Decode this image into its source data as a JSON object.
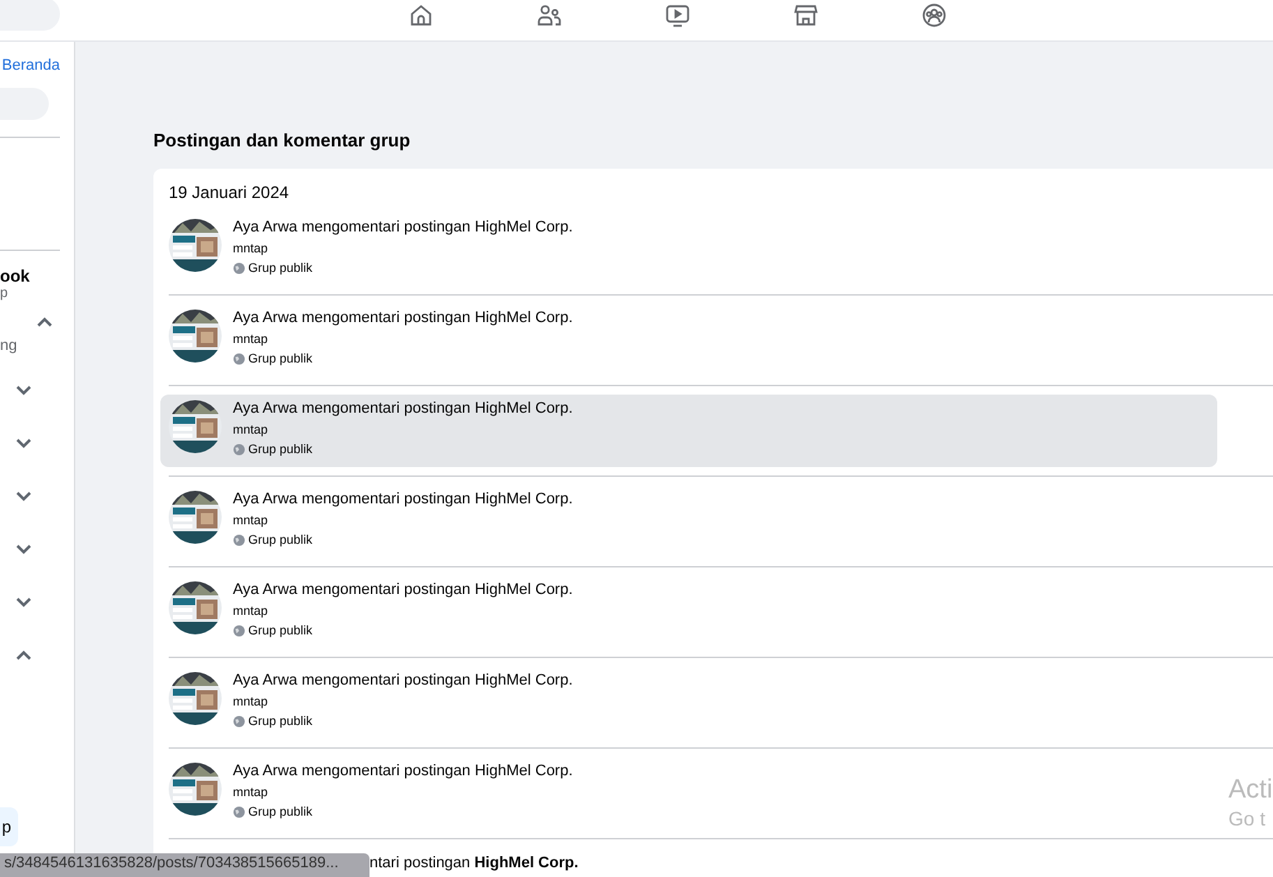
{
  "top_nav": {
    "tabs": [
      {
        "selected": false
      },
      {
        "selected": false
      },
      {
        "selected": false
      },
      {
        "selected": false
      },
      {
        "selected": false
      }
    ]
  },
  "sidebar": {
    "link": "Beranda",
    "heading": "ook",
    "subheading": "p",
    "sections": [
      {
        "label": "ng",
        "expanded": true
      },
      {
        "expanded": false
      },
      {
        "expanded": false
      },
      {
        "expanded": false
      },
      {
        "expanded": false
      },
      {
        "expanded": false
      },
      {
        "expanded": true
      }
    ],
    "button": "p"
  },
  "main": {
    "title": "Postingan dan komentar grup",
    "date": "19 Januari 2024",
    "rows": [
      {
        "actor": "Aya Arwa",
        "action": "mengomentari postingan",
        "target": "HighMel Corp.",
        "comment": "mntap",
        "audience": "Grup publik",
        "selected": false
      },
      {
        "actor": "Aya Arwa",
        "action": "mengomentari postingan",
        "target": "HighMel Corp.",
        "comment": "mntap",
        "audience": "Grup publik",
        "selected": false
      },
      {
        "actor": "Aya Arwa",
        "action": "mengomentari postingan",
        "target": "HighMel Corp.",
        "comment": "mntap",
        "audience": "Grup publik",
        "selected": true
      },
      {
        "actor": "Aya Arwa",
        "action": "mengomentari postingan",
        "target": "HighMel Corp.",
        "comment": "mntap",
        "audience": "Grup publik",
        "selected": false
      },
      {
        "actor": "Aya Arwa",
        "action": "mengomentari postingan",
        "target": "HighMel Corp.",
        "comment": "mntap",
        "audience": "Grup publik",
        "selected": false
      },
      {
        "actor": "Aya Arwa",
        "action": "mengomentari postingan",
        "target": "HighMel Corp.",
        "comment": "mntap",
        "audience": "Grup publik",
        "selected": false
      },
      {
        "actor": "Aya Arwa",
        "action": "mengomentari postingan",
        "target": "HighMel Corp.",
        "comment": "mntap",
        "audience": "Grup publik",
        "selected": false
      }
    ],
    "partial_row": "ntari postingan **HighMel Corp.**"
  },
  "status_url": "s/3484546131635828/posts/703438515665189...",
  "os_notice": [
    "Acti",
    "Go t"
  ]
}
